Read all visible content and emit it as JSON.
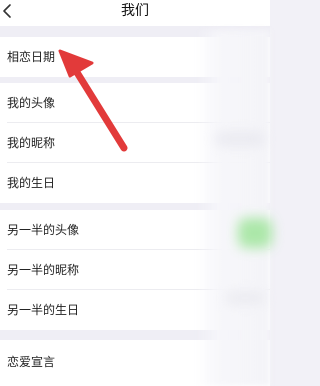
{
  "header": {
    "title": "我们",
    "back_icon": "chevron-left-icon"
  },
  "groups": [
    {
      "items": [
        {
          "label": "相恋日期"
        }
      ]
    },
    {
      "items": [
        {
          "label": "我的头像"
        },
        {
          "label": "我的昵称"
        },
        {
          "label": "我的生日"
        }
      ]
    },
    {
      "items": [
        {
          "label": "另一半的头像"
        },
        {
          "label": "另一半的昵称"
        },
        {
          "label": "另一半的生日"
        }
      ]
    },
    {
      "items": [
        {
          "label": "恋爱宣言"
        }
      ]
    }
  ],
  "annotation": {
    "arrow_color": "#e23a3a",
    "arrow_icon": "red-arrow-annotation"
  },
  "colors": {
    "background": "#f2f1f7",
    "card": "#ffffff",
    "accent_blur_green": "#8ee08a"
  }
}
